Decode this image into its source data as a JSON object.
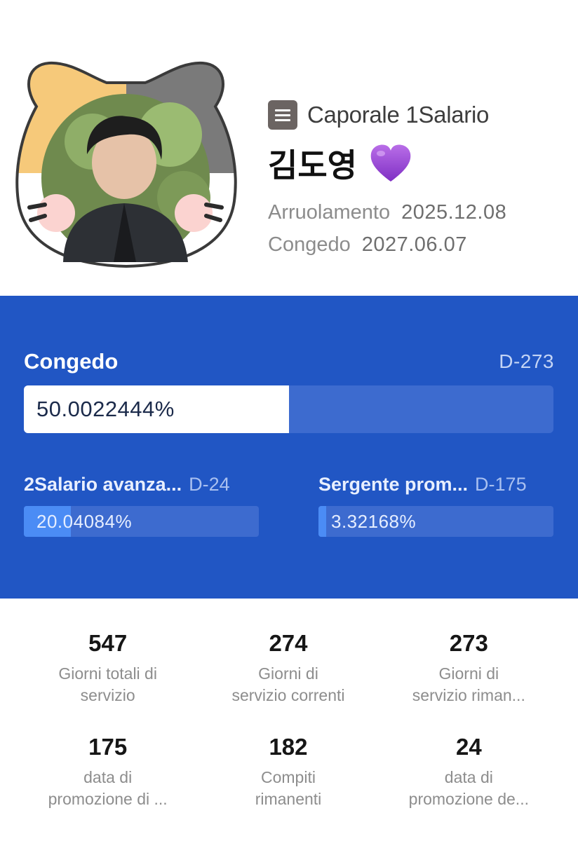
{
  "profile": {
    "rank_label": "Caporale 1Salario",
    "rank_icon": "menu-icon",
    "name": "김도영",
    "name_emoji_icon": "purple-heart-icon",
    "enlist_label": "Arruolamento",
    "enlist_date": "2025.12.08",
    "discharge_label": "Congedo",
    "discharge_date": "2027.06.07"
  },
  "progress": {
    "main": {
      "title": "Congedo",
      "d_day": "D-273",
      "percent_text": "50.0022444%",
      "fraction": 0.500022444
    },
    "sub": [
      {
        "title": "2Salario avanza...",
        "d_day": "D-24",
        "percent_text": "20.04084%",
        "fraction": 0.2004084
      },
      {
        "title": "Sergente prom...",
        "d_day": "D-175",
        "percent_text": "3.32168%",
        "fraction": 0.0332168
      }
    ]
  },
  "stats": [
    {
      "value": "547",
      "label": "Giorni totali di\nservizio"
    },
    {
      "value": "274",
      "label": "Giorni di\nservizio correnti"
    },
    {
      "value": "273",
      "label": "Giorni di\nservizio riman..."
    },
    {
      "value": "175",
      "label": "data di\npromozione di ..."
    },
    {
      "value": "182",
      "label": "Compiti\nrimanenti"
    },
    {
      "value": "24",
      "label": "data di\npromozione de..."
    }
  ],
  "colors": {
    "panel_bg": "#2156c4",
    "bar_track": "#3d6bcf",
    "main_fill": "#ffffff",
    "sub_fill": "#4b8cf5",
    "rank_icon_bg": "#6b6462",
    "cat_orange": "#f6c97a",
    "cat_gray": "#7a7a7a",
    "heart": "#9b4fd6"
  }
}
